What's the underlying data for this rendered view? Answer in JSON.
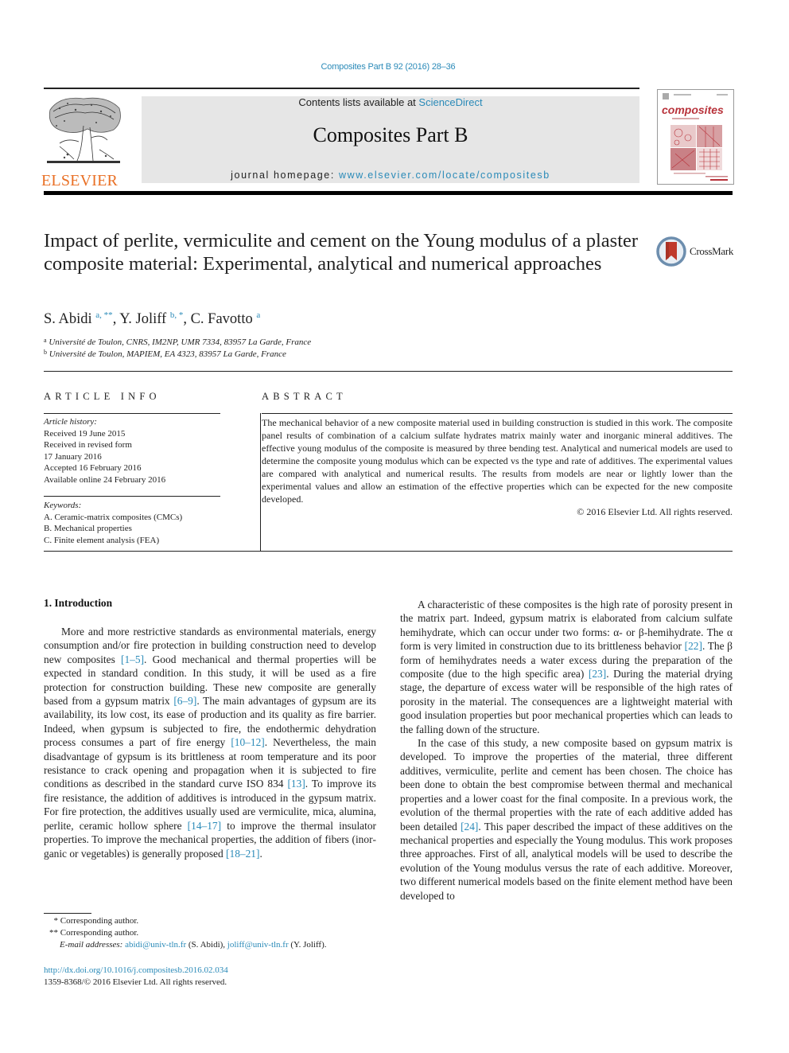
{
  "header": {
    "citation": "Composites Part B 92 (2016) 28–36",
    "contents_prefix": "Contents lists available at ",
    "contents_link": "ScienceDirect",
    "journal_title": "Composites Part B",
    "homepage_prefix": "journal homepage: ",
    "homepage_link": "www.elsevier.com/locate/compositesb",
    "publisher_logo_text": "ELSEVIER",
    "cover_title": "composites",
    "cover_subtitle": "Part B: engineering"
  },
  "article": {
    "title": "Impact of perlite, vermiculite and cement on the Young modulus of a plaster composite material: Experimental, analytical and numerical approaches",
    "crossmark_label": "CrossMark",
    "authors": [
      {
        "name": "S. Abidi",
        "marks": "a, **"
      },
      {
        "name": "Y. Joliff",
        "marks": "b, *"
      },
      {
        "name": "C. Favotto",
        "marks": "a"
      }
    ],
    "affiliations": [
      {
        "mark": "a",
        "text": "Université de Toulon, CNRS, IM2NP, UMR 7334, 83957 La Garde, France"
      },
      {
        "mark": "b",
        "text": "Université de Toulon, MAPIEM, EA 4323, 83957 La Garde, France"
      }
    ]
  },
  "article_info": {
    "heading": "ARTICLE INFO",
    "history_label": "Article history:",
    "history": [
      "Received 19 June 2015",
      "Received in revised form",
      "17 January 2016",
      "Accepted 16 February 2016",
      "Available online 24 February 2016"
    ],
    "keywords_label": "Keywords:",
    "keywords": [
      "A. Ceramic-matrix composites (CMCs)",
      "B. Mechanical properties",
      "C. Finite element analysis (FEA)"
    ]
  },
  "abstract": {
    "heading": "ABSTRACT",
    "text": "The mechanical behavior of a new composite material used in building construction is studied in this work. The composite panel results of combination of a calcium sulfate hydrates matrix mainly water and inorganic mineral additives. The effective young modulus of the composite is measured by three bending test. Analytical and numerical models are used to determine the composite young modulus which can be expected vs the type and rate of additives. The experimental values are compared with analytical and numerical results. The results from models are near or lightly lower than the experimental values and allow an estimation of the effective properties which can be expected for the new composite developed.",
    "copyright": "© 2016 Elsevier Ltd. All rights reserved."
  },
  "body": {
    "section_heading": "1.  Introduction",
    "left_paragraph": [
      {
        "t": "More and more restrictive standards as environmental mate­rials, energy consumption and/or fire protection in building con­struction need to develop new composites "
      },
      {
        "ref": "[1–5]"
      },
      {
        "t": ". Good mechanical and thermal properties will be expected in standard condition. In this study, it will be used as a fire protection for construction building. These new composite are generally based from a gypsum matrix "
      },
      {
        "ref": "[6–9]"
      },
      {
        "t": ". The main advantages of gypsum are its availability, its low cost, its ease of production and its quality as fire barrier. Indeed, when gypsum is subjected to fire, the endothermic dehydration process consumes a part of fire energy "
      },
      {
        "ref": "[10–12]"
      },
      {
        "t": ". Nevertheless, the main disadvantage of gypsum is its brittleness at room temperature and its poor resistance to crack opening and propagation when it is subjected to fire conditions as described in the standard curve ISO 834 "
      },
      {
        "ref": "[13]"
      },
      {
        "t": ". To improve its fire resistance, the addition of additives is introduced in the gypsum matrix. For fire protection, the additives usually used are vermiculite, mica, alumina, perlite, ceramic hollow sphere "
      },
      {
        "ref": "[14–17]"
      },
      {
        "t": " to improve the thermal insulator properties. To improve the mechanical properties, the addition of fibers (inor­ganic or vegetables) is generally proposed "
      },
      {
        "ref": "[18–21]"
      },
      {
        "t": "."
      }
    ],
    "right_paragraph_1": [
      {
        "t": "A characteristic of these composites is the high rate of porosity present in the matrix part. Indeed, gypsum matrix is elaborated from calcium sulfate hemihydrate, which can occur under two forms: α- or β-hemihydrate. The α form is very limited in con­struction due to its brittleness behavior "
      },
      {
        "ref": "[22]"
      },
      {
        "t": ". The β form of hemi­hydrates needs a water excess during the preparation of the composite (due to the high specific area) "
      },
      {
        "ref": "[23]"
      },
      {
        "t": ". During the material drying stage, the departure of excess water will be responsible of the high rates of porosity in the material. The consequences are a lightweight material with good insulation properties but poor mechanical properties which can leads to the falling down of the structure."
      }
    ],
    "right_paragraph_2": [
      {
        "t": "In the case of this study, a new composite based on gypsum matrix is developed. To improve the properties of the material, three different additives, vermiculite, perlite and cement has been chosen. The choice has been done to obtain the best compromise between thermal and mechanical properties and a lower coast for the final composite. In a previous work, the evolution of the ther­mal properties with the rate of each additive added has been detailed "
      },
      {
        "ref": "[24]"
      },
      {
        "t": ". This paper described the impact of these additives on the mechanical properties and especially the Young modulus. This work proposes three approaches. First of all, analytical models will be used to describe the evolution of the Young modulus versus the rate of each additive. Moreover, two different numerical models based on the finite element method have been developed to"
      }
    ]
  },
  "footnotes": {
    "fn1_mark": "*",
    "fn1_text": "Corresponding author.",
    "fn2_mark": "**",
    "fn2_text": "Corresponding author.",
    "email_label": "E-mail addresses:",
    "email1": "abidi@univ-tln.fr",
    "email1_owner": " (S. Abidi), ",
    "email2": "joliff@univ-tln.fr",
    "email2_owner": " (Y. Joliff).",
    "doi": "http://dx.doi.org/10.1016/j.compositesb.2016.02.034",
    "issn_copyright": "1359-8368/© 2016 Elsevier Ltd. All rights reserved."
  },
  "colors": {
    "link": "#2a8ab8",
    "elsevier_orange": "#e97025",
    "banner_gray": "#e6e6e6",
    "cover_red": "#b8323a"
  }
}
